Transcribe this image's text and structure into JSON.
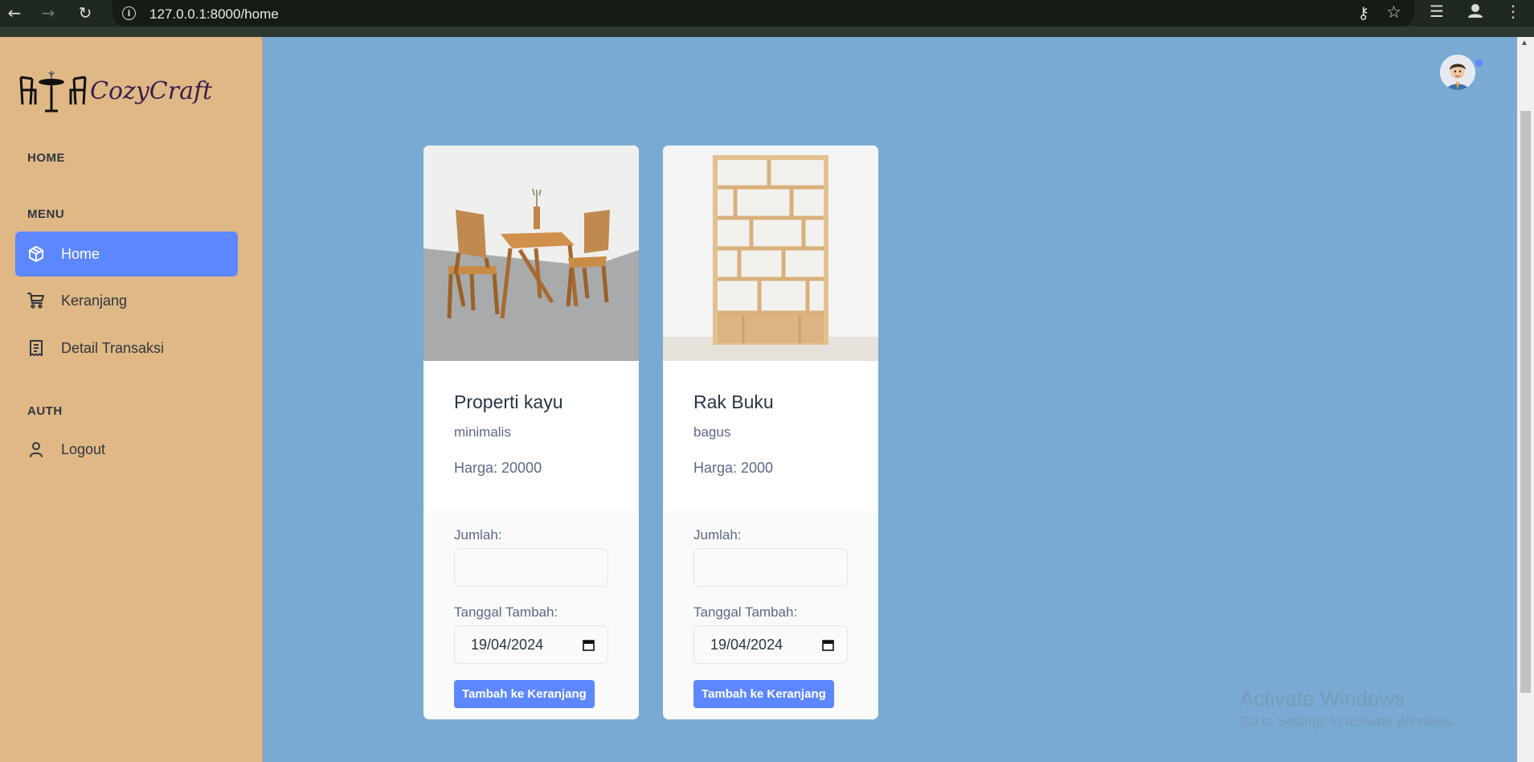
{
  "browser": {
    "url": "127.0.0.1:8000/home"
  },
  "sidebar": {
    "logo_text": "CozyCraft",
    "sections": {
      "home": "HOME",
      "menu": "MENU",
      "auth": "AUTH"
    },
    "items": [
      {
        "label": "Home",
        "icon": "box-icon",
        "active": true
      },
      {
        "label": "Keranjang",
        "icon": "cart-icon",
        "active": false
      },
      {
        "label": "Detail Transaksi",
        "icon": "receipt-icon",
        "active": false
      },
      {
        "label": "Logout",
        "icon": "user-icon",
        "active": false
      }
    ]
  },
  "products": [
    {
      "name": "Properti kayu",
      "description": "minimalis",
      "price": "Harga: 20000",
      "qty_label": "Jumlah:",
      "qty_value": "",
      "date_label": "Tanggal Tambah:",
      "date_value": "19/04/2024",
      "button": "Tambah ke Keranjang"
    },
    {
      "name": "Rak Buku",
      "description": "bagus",
      "price": "Harga: 2000",
      "qty_label": "Jumlah:",
      "qty_value": "",
      "date_label": "Tanggal Tambah:",
      "date_value": "19/04/2024",
      "button": "Tambah ke Keranjang"
    }
  ],
  "watermark": {
    "line1": "Activate Windows",
    "line2": "Go to Settings to activate Windows."
  },
  "colors": {
    "page_bg": "#78aad4",
    "sidebar_bg": "#dfb886",
    "accent": "#5d87ff"
  }
}
